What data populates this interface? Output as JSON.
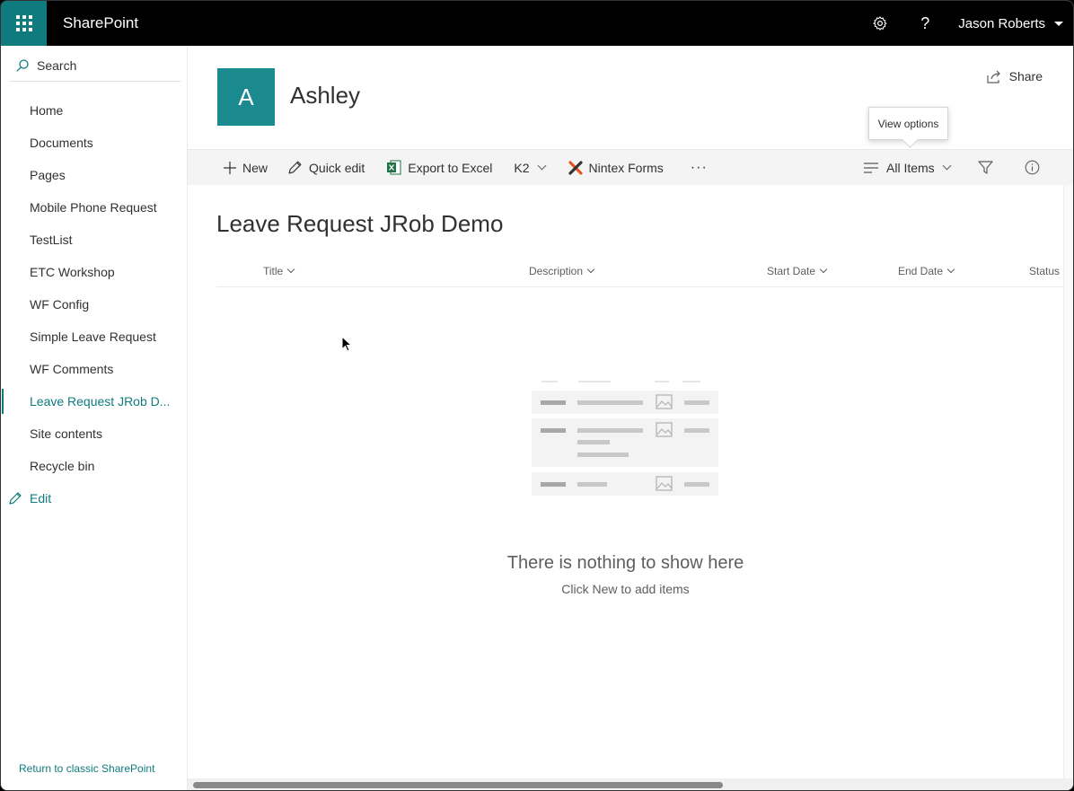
{
  "suite": {
    "brand": "SharePoint",
    "user_name": "Jason Roberts"
  },
  "leftnav": {
    "search_label": "Search",
    "items": [
      {
        "label": "Home"
      },
      {
        "label": "Documents"
      },
      {
        "label": "Pages"
      },
      {
        "label": "Mobile Phone Request"
      },
      {
        "label": "TestList"
      },
      {
        "label": "ETC Workshop"
      },
      {
        "label": "WF Config"
      },
      {
        "label": "Simple Leave Request"
      },
      {
        "label": "WF Comments"
      },
      {
        "label": "Leave Request JRob D...",
        "active": true
      },
      {
        "label": "Site contents"
      },
      {
        "label": "Recycle bin"
      }
    ],
    "edit_label": "Edit",
    "classic_link": "Return to classic SharePoint"
  },
  "site": {
    "logo_letter": "A",
    "title": "Ashley",
    "share_label": "Share",
    "accent_color": "#0f7b7e"
  },
  "tooltip": {
    "text": "View options"
  },
  "commandbar": {
    "new_label": "New",
    "quick_edit_label": "Quick edit",
    "export_label": "Export to Excel",
    "k2_label": "K2",
    "nintex_label": "Nintex Forms",
    "more_label": "···",
    "view_label": "All Items"
  },
  "list": {
    "title": "Leave Request JRob Demo",
    "columns": [
      "Title",
      "Description",
      "Start Date",
      "End Date",
      "Status"
    ],
    "empty_title": "There is nothing to show here",
    "empty_subtitle": "Click New to add items"
  }
}
